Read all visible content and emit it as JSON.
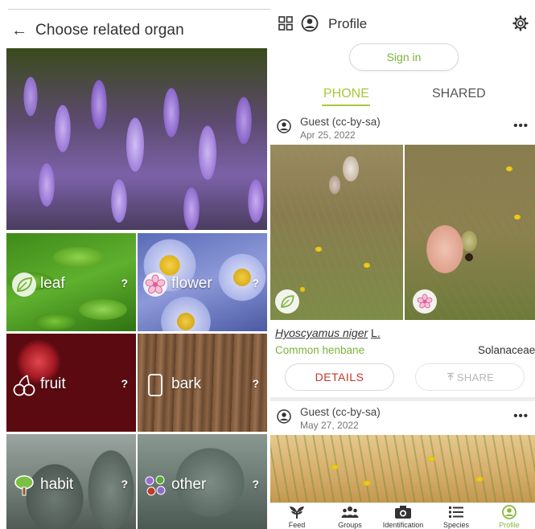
{
  "left": {
    "header": {
      "title": "Choose related organ"
    },
    "organs": [
      {
        "label": "leaf",
        "help": "?"
      },
      {
        "label": "flower",
        "help": "?"
      },
      {
        "label": "fruit",
        "help": "?"
      },
      {
        "label": "bark",
        "help": "?"
      },
      {
        "label": "habit",
        "help": "?"
      },
      {
        "label": "other",
        "help": "?"
      }
    ]
  },
  "right": {
    "header": {
      "title": "Profile"
    },
    "signin_label": "Sign in",
    "tabs": [
      {
        "label": "PHONE",
        "active": true
      },
      {
        "label": "SHARED",
        "active": false
      }
    ],
    "observations": [
      {
        "user": "Guest (cc-by-sa)",
        "date": "Apr 25, 2022",
        "more": "•••",
        "scientific_name": "Hyoscyamus niger",
        "author": "L.",
        "common_name": "Common henbane",
        "family": "Solanaceae",
        "details_label": "DETAILS",
        "share_label": "SHARE"
      },
      {
        "user": "Guest (cc-by-sa)",
        "date": "May 27, 2022",
        "more": "•••"
      }
    ],
    "nav": [
      {
        "label": "Feed"
      },
      {
        "label": "Groups"
      },
      {
        "label": "Identification"
      },
      {
        "label": "Species"
      },
      {
        "label": "Profile"
      }
    ]
  },
  "colors": {
    "accent_green": "#a8c83a",
    "link_green": "#7bb33a",
    "details_red": "#c0392b"
  }
}
